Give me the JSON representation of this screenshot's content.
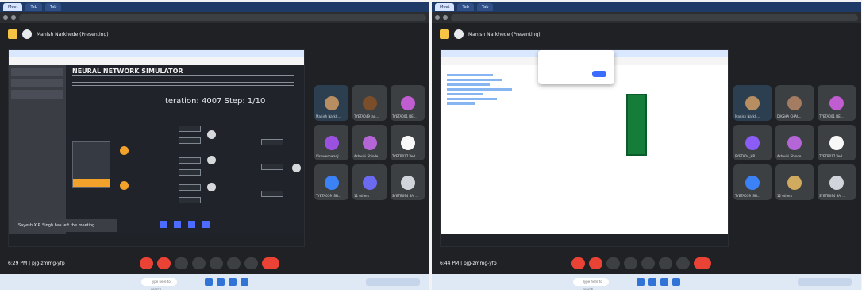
{
  "screens": [
    {
      "presenting": "Manish Narkhede (Presenting)",
      "simulator_title": "NEURAL NETWORK SIMULATOR",
      "iteration": "Iteration: 4007 Step: 1/10",
      "time": "6:29 PM",
      "meeting_code": "pjg-zmmg-yfp",
      "toast": "Sayesh X.P. Singh has left the meeting",
      "tiles": [
        "Manish Narkh...",
        "TYETA049 Jan...",
        "TYETA001 DE...",
        "Vishweshwar J...",
        "Ashwini Shinde",
        "TYETB017 Ved...",
        "TYETA039 ISH...",
        "11 others",
        "SYETB094 SAI ..."
      ]
    },
    {
      "presenting": "Manish Narkhede (Presenting)",
      "time": "6:44 PM",
      "meeting_code": "pjg-zmmg-yfp",
      "tiles": [
        "Manish Narkh...",
        "DIKSHA CHAU...",
        "TYETA001 DE...",
        "BYETA04_HR...",
        "Ashwini Shinde",
        "TYETB017 Ved...",
        "TYETA039 ISH...",
        "12 others",
        "SYETB094 SAI ..."
      ]
    }
  ],
  "taskbar": {
    "search": "Type here to search"
  },
  "colors": {
    "meet_bg": "#202124",
    "leave": "#ea4335",
    "accent_orange": "#f2a12a",
    "blue": "#3c6cff"
  }
}
